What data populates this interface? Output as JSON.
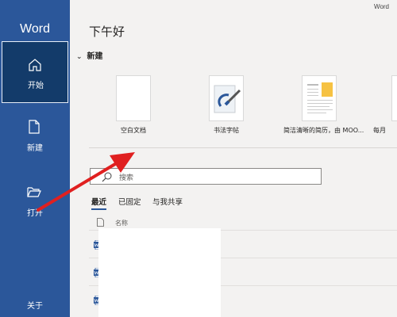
{
  "sidebar": {
    "app_name": "Word",
    "items": [
      {
        "label": "开始",
        "icon": "home-icon"
      },
      {
        "label": "新建",
        "icon": "new-document-icon"
      },
      {
        "label": "打开",
        "icon": "folder-open-icon"
      }
    ],
    "bottom_label": "关于"
  },
  "header": {
    "app_label": "Word",
    "greeting": "下午好"
  },
  "new_section": {
    "title": "新建",
    "templates": [
      {
        "label": "空白文档"
      },
      {
        "label": "书法字帖"
      },
      {
        "label": "简洁清晰的简历，由 MOO..."
      },
      {
        "label": "每月"
      }
    ]
  },
  "search": {
    "placeholder": "搜索"
  },
  "tabs": [
    {
      "label": "最近"
    },
    {
      "label": "已固定"
    },
    {
      "label": "与我共享"
    }
  ],
  "file_list": {
    "column_name": "名称"
  },
  "colors": {
    "sidebar": "#2b579a",
    "active_nav": "#133b6a",
    "main_bg": "#f3f2f1",
    "annotation_arrow": "#e02020"
  }
}
